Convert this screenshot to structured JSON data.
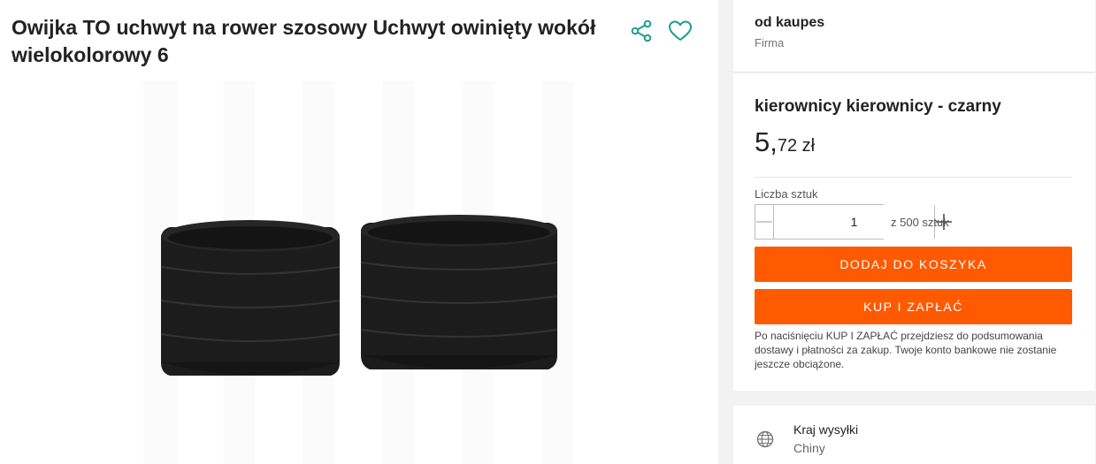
{
  "product": {
    "title": "Owijka TO uchwyt na rower szosowy Uchwyt owinięty wokół wielokolorowy 6"
  },
  "icons": {
    "share": "share-icon",
    "favorite": "heart-icon",
    "shipping": "globe-icon"
  },
  "seller": {
    "name": "od kaupes",
    "type": "Firma"
  },
  "offer": {
    "variant": "kierownicy kierownicy - czarny",
    "price_int": "5,",
    "price_dec": "72 zł",
    "quantity_label": "Liczba sztuk",
    "quantity_value": "1",
    "stock_text": "z 500 sztuk",
    "add_to_cart_label": "DODAJ DO KOSZYKA",
    "buy_now_label": "KUP I ZAPŁAĆ",
    "note": "Po naciśnięciu KUP I ZAPŁAĆ przejdziesz do podsumowania dostawy i płatności za zakup. Twoje konto bankowe nie zostanie jeszcze obciążone."
  },
  "shipping": {
    "label": "Kraj wysyłki",
    "value": "Chiny"
  },
  "colors": {
    "accent": "#ff5a00",
    "icon_teal": "#1a9e8f",
    "product_black": "#1c1c1c"
  }
}
